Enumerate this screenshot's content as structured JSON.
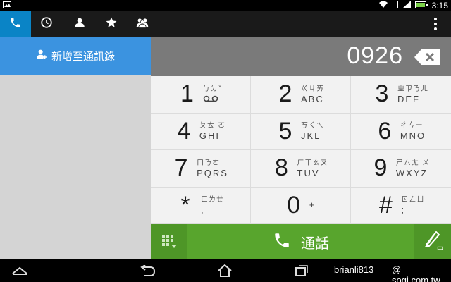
{
  "status_bar": {
    "time": "3:15"
  },
  "tabs": [
    {
      "icon": "phone-icon",
      "active": true
    },
    {
      "icon": "clock-icon",
      "active": false
    },
    {
      "icon": "person-icon",
      "active": false
    },
    {
      "icon": "star-icon",
      "active": false
    },
    {
      "icon": "group-icon",
      "active": false
    }
  ],
  "left_pane": {
    "add_contact_label": "新增至通訊錄"
  },
  "dialer": {
    "number": "0926",
    "keys": [
      {
        "digit": "1",
        "zhuyin": "ㄅㄉˇ",
        "letters": "ꝏ"
      },
      {
        "digit": "2",
        "zhuyin": "ㄍㄐㄞ",
        "letters": "ABC"
      },
      {
        "digit": "3",
        "zhuyin": "ㄓㄗㄋㄦ",
        "letters": "DEF"
      },
      {
        "digit": "4",
        "zhuyin": "ㄆㄊ ㄛ",
        "letters": "GHI"
      },
      {
        "digit": "5",
        "zhuyin": "ㄎㄑㄟ",
        "letters": "JKL"
      },
      {
        "digit": "6",
        "zhuyin": "ㄔㄘㄧ",
        "letters": "MNO"
      },
      {
        "digit": "7",
        "zhuyin": "ㄇㄋㄜ",
        "letters": "PQRS"
      },
      {
        "digit": "8",
        "zhuyin": "ㄏㄒㄠㄡ",
        "letters": "TUV"
      },
      {
        "digit": "9",
        "zhuyin": "ㄕㄙㄤ ㄨ",
        "letters": "WXYZ"
      },
      {
        "digit": "*",
        "zhuyin": "ㄈㄌㄝ",
        "letters": ","
      },
      {
        "digit": "0",
        "zhuyin": "",
        "letters": "+"
      },
      {
        "digit": "#",
        "zhuyin": "ㄖㄥㄩ",
        "letters": ";"
      }
    ],
    "call_label": "通話",
    "ime_label": "中"
  },
  "watermark": {
    "left": "brianli813",
    "right": "@ sogi.com.tw"
  },
  "colors": {
    "accent": "#0a84c6",
    "call_green": "#58a52d",
    "add_contact_blue": "#3b93e0"
  }
}
